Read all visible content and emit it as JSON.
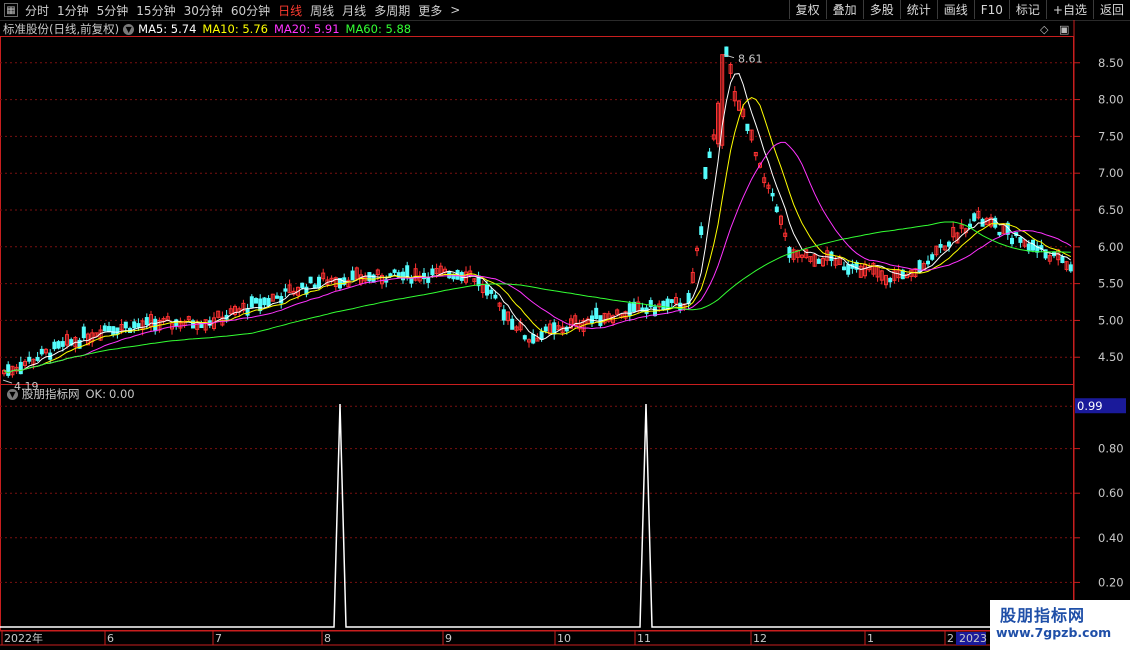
{
  "toolbar": {
    "periods": [
      "分时",
      "1分钟",
      "5分钟",
      "15分钟",
      "30分钟",
      "60分钟",
      "日线",
      "周线",
      "月线",
      "多周期",
      "更多"
    ],
    "active_period": "日线",
    "right_buttons": [
      "复权",
      "叠加",
      "多股",
      "统计",
      "画线",
      "F10",
      "标记",
      "+自选",
      "返回"
    ]
  },
  "header": {
    "stock_title": "标准股份(日线,前复权)",
    "ma": [
      {
        "label": "MA5:",
        "value": "5.74",
        "color": "#ffffff"
      },
      {
        "label": "MA10:",
        "value": "5.76",
        "color": "#ffff00"
      },
      {
        "label": "MA20:",
        "value": "5.91",
        "color": "#ff33ff"
      },
      {
        "label": "MA60:",
        "value": "5.88",
        "color": "#33ff33"
      }
    ]
  },
  "indicator": {
    "name": "股朋指标网",
    "label": "OK:",
    "value": "0.00"
  },
  "colors": {
    "up": "#ff3232",
    "down": "#54fcfc",
    "grid": "#7a1010",
    "axis": "#c81e1e"
  },
  "chart_data": [
    {
      "type": "candlestick",
      "y_axis": {
        "ticks": [
          "8.50",
          "8.00",
          "7.50",
          "7.00",
          "6.50",
          "6.00",
          "5.50",
          "5.00",
          "4.50"
        ],
        "ylim": [
          4.15,
          8.85
        ]
      },
      "x_axis": {
        "labels": [
          "2022年",
          "6",
          "7",
          "8",
          "9",
          "10",
          "11",
          "12",
          "1",
          "2",
          "2023"
        ]
      },
      "annotations": {
        "high": "8.61",
        "low": "4.19"
      },
      "ma_series": [
        "MA5",
        "MA10",
        "MA20",
        "MA60"
      ],
      "ohlc_anchors": [
        {
          "x": "2022-05",
          "price": 4.3
        },
        {
          "x": "2022-06",
          "price": 4.9
        },
        {
          "x": "2022-07",
          "price": 5.0
        },
        {
          "x": "2022-08",
          "price": 5.55
        },
        {
          "x": "2022-09",
          "price": 5.65
        },
        {
          "x": "2022-09-end",
          "price": 4.75
        },
        {
          "x": "2022-10",
          "price": 5.05
        },
        {
          "x": "2022-11",
          "price": 5.25
        },
        {
          "x": "2022-11-peak",
          "price": 8.61
        },
        {
          "x": "2022-12",
          "price": 5.95
        },
        {
          "x": "2023-01",
          "price": 5.55
        },
        {
          "x": "2023-02",
          "price": 6.4
        },
        {
          "x": "2023-02-end",
          "price": 5.74
        }
      ]
    },
    {
      "type": "line",
      "y_axis": {
        "ticks": [
          "0.99",
          "0.80",
          "0.60",
          "0.40",
          "0.20"
        ],
        "ylim": [
          0,
          1
        ]
      },
      "series": [
        {
          "name": "OK",
          "spikes_at": [
            "2022-08",
            "2022-11"
          ],
          "value": 1
        }
      ]
    }
  ]
}
